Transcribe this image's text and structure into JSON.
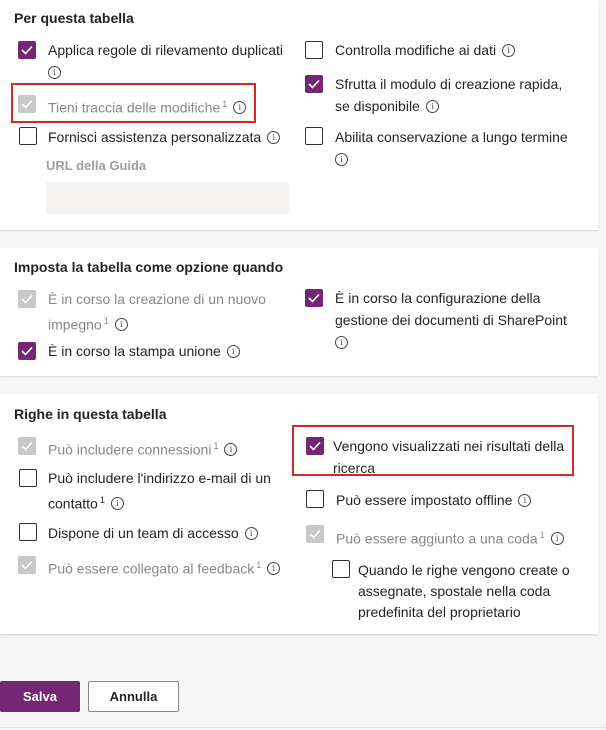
{
  "section1": {
    "title": "Per questa tabella",
    "items": {
      "dup": "Applica regole di rilevamento duplicati",
      "track": "Tieni traccia delle modifiche",
      "assist": "Fornisci assistenza personalizzata",
      "audit": "Controlla modifiche ai dati",
      "quick1": "Sfrutta il modulo di creazione rapida,",
      "quick2": "se disponibile",
      "retention": "Abilita conservazione a lungo termine"
    },
    "url_label": "URL della Guida",
    "url_placeholder": ""
  },
  "section2": {
    "title": "Imposta la tabella come opzione quando",
    "items": {
      "engage1": "È in corso la creazione di un nuovo",
      "engage2": "impegno",
      "mail": "È in corso la stampa unione",
      "sp1": "È in corso la configurazione della",
      "sp2": "gestione dei documenti di SharePoint"
    }
  },
  "section3": {
    "title": "Righe in questa tabella",
    "items": {
      "conn": "Può includere connessioni",
      "email1": "Può includere l'indirizzo e-mail di un",
      "email2": "contatto",
      "team": "Dispone di un team di accesso",
      "feedback": "Può essere collegato al feedback",
      "search1": "Vengono visualizzati nei risultati della",
      "search2": "ricerca",
      "offline": "Può essere impostato offline",
      "queue": "Può essere aggiunto a una coda",
      "move1": "Quando le righe vengono create o",
      "move2": "assegnate, spostale nella coda",
      "move3": "predefinita del proprietario"
    }
  },
  "footnote_marker": "1",
  "info_glyph": "i",
  "buttons": {
    "save": "Salva",
    "cancel": "Annulla"
  },
  "colors": {
    "accent": "#742774",
    "highlight": "#d9262a",
    "disabled_check": "#c8c8c8"
  }
}
